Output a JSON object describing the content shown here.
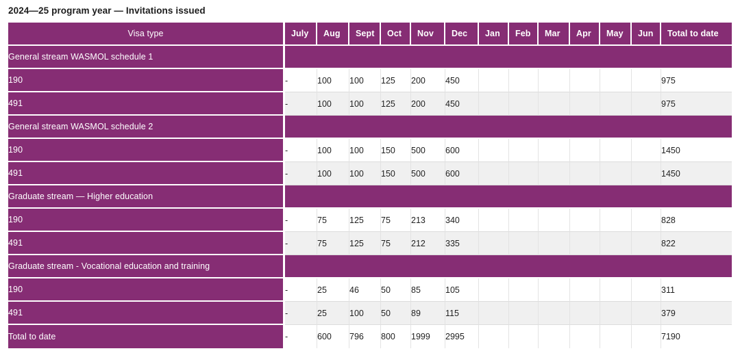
{
  "page": {
    "title": "2024—25 program year — Invitations issued",
    "accent_color": "#862d74",
    "stripe_color": "#f0f0f0",
    "text_color": "#1f1f1f"
  },
  "table": {
    "columns": [
      "Visa type",
      "July",
      "Aug",
      "Sept",
      "Oct",
      "Nov",
      "Dec",
      "Jan",
      "Feb",
      "Mar",
      "Apr",
      "May",
      "Jun",
      "Total to date"
    ],
    "rows": [
      {
        "type": "section",
        "label": "General stream WASMOL schedule 1"
      },
      {
        "type": "data",
        "label": "190",
        "values": [
          "-",
          "100",
          "100",
          "125",
          "200",
          "450",
          "",
          "",
          "",
          "",
          "",
          "",
          "975"
        ]
      },
      {
        "type": "data",
        "label": "491",
        "values": [
          "-",
          "100",
          "100",
          "125",
          "200",
          "450",
          "",
          "",
          "",
          "",
          "",
          "",
          "975"
        ]
      },
      {
        "type": "section",
        "label": "General stream WASMOL schedule 2"
      },
      {
        "type": "data",
        "label": "190",
        "values": [
          "-",
          "100",
          "100",
          "150",
          "500",
          "600",
          "",
          "",
          "",
          "",
          "",
          "",
          "1450"
        ]
      },
      {
        "type": "data",
        "label": "491",
        "values": [
          "-",
          "100",
          "100",
          "150",
          "500",
          "600",
          "",
          "",
          "",
          "",
          "",
          "",
          "1450"
        ]
      },
      {
        "type": "section",
        "label": "Graduate stream — Higher education"
      },
      {
        "type": "data",
        "label": "190",
        "values": [
          "-",
          "75",
          "125",
          "75",
          "213",
          "340",
          "",
          "",
          "",
          "",
          "",
          "",
          "828"
        ]
      },
      {
        "type": "data",
        "label": "491",
        "values": [
          "-",
          "75",
          "125",
          "75",
          "212",
          "335",
          "",
          "",
          "",
          "",
          "",
          "",
          "822"
        ]
      },
      {
        "type": "section",
        "label": "Graduate stream - Vocational education and training"
      },
      {
        "type": "data",
        "label": "190",
        "values": [
          "-",
          "25",
          "46",
          "50",
          "85",
          "105",
          "",
          "",
          "",
          "",
          "",
          "",
          "311"
        ]
      },
      {
        "type": "data",
        "label": "491",
        "values": [
          "-",
          "25",
          "100",
          "50",
          "89",
          "115",
          "",
          "",
          "",
          "",
          "",
          "",
          "379"
        ]
      },
      {
        "type": "data",
        "label": "Total to date",
        "values": [
          "-",
          "600",
          "796",
          "800",
          "1999",
          "2995",
          "",
          "",
          "",
          "",
          "",
          "",
          "7190"
        ]
      }
    ]
  }
}
